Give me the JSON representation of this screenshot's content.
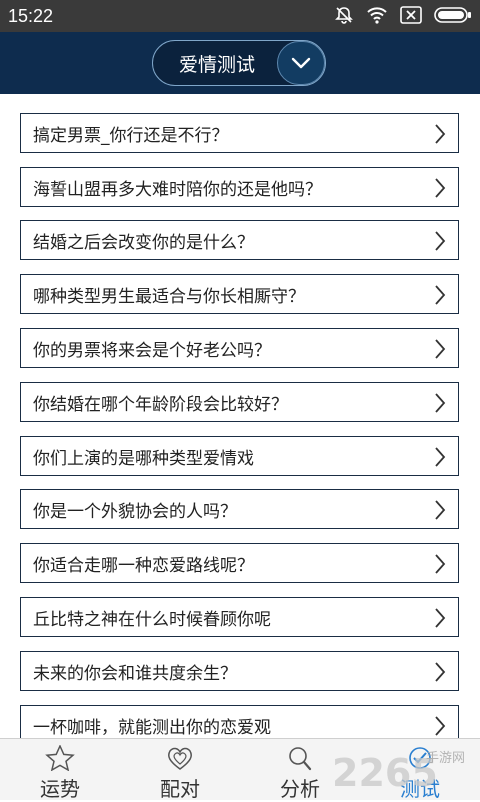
{
  "status_bar": {
    "time": "15:22",
    "icons": [
      "bell-off-icon",
      "wifi-icon",
      "sim-x-icon",
      "battery-icon"
    ]
  },
  "header": {
    "title": "爱情测试",
    "dropdown_icon": "chevron-down-icon"
  },
  "list": {
    "items": [
      "搞定男票_你行还是不行？",
      "海誓山盟再多大难时陪你的还是他吗？",
      "结婚之后会改变你的是什么？",
      "哪种类型男生最适合与你长相厮守？",
      "你的男票将来会是个好老公吗？",
      "你结婚在哪个年龄阶段会比较好？",
      "你们上演的是哪种类型爱情戏",
      "你是一个外貌协会的人吗？",
      "你适合走哪一种恋爱路线呢？",
      "丘比特之神在什么时候眷顾你呢",
      "未来的你会和谁共度余生？",
      "一杯咖啡，就能测出你的恋爱观"
    ]
  },
  "tabbar": {
    "tabs": [
      {
        "label": "运势",
        "icon": "star-icon"
      },
      {
        "label": "配对",
        "icon": "hearts-icon"
      },
      {
        "label": "分析",
        "icon": "magnifier-icon"
      },
      {
        "label": "测试",
        "icon": "test-icon"
      }
    ],
    "active_index": 3
  },
  "watermark": {
    "number": "2265",
    "brand": "手游网"
  },
  "colors": {
    "header_bg": "#0e2c4e",
    "active_tab": "#2a7fd0",
    "status_bar": "#3a3a3a"
  }
}
